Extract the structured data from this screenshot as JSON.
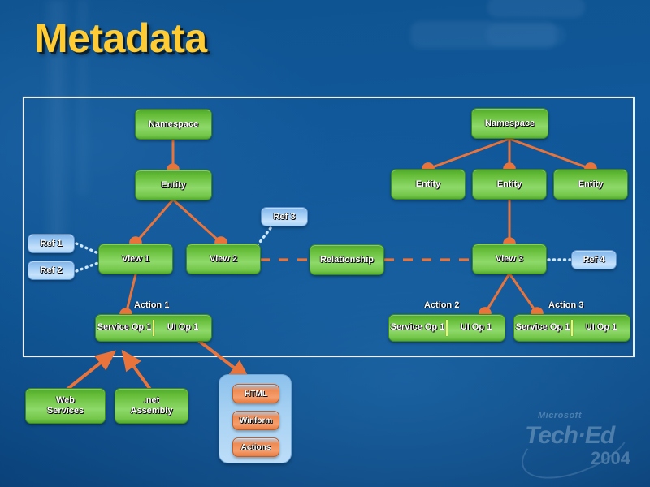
{
  "slide": {
    "title": "Metadata",
    "title_color": "#FFCC33",
    "background_color": "#0f5390"
  },
  "colors": {
    "node_green": "#7ecb4e",
    "node_blue": "#a8d2f3",
    "node_orange": "#ef8a52",
    "connector_orange": "#e8743c",
    "frame_border": "#e9f3f7",
    "divider_yellow": "#f2f277"
  },
  "diagram": {
    "left_tree": {
      "namespace": "Namespace",
      "entity": "Entity",
      "views": [
        "View 1",
        "View 2"
      ],
      "refs": [
        "Ref 1",
        "Ref 2",
        "Ref 3"
      ],
      "action_label": "Action 1",
      "action_cells": [
        "Service Op 1",
        "UI Op 1"
      ]
    },
    "center": {
      "relationship": "Relationship"
    },
    "right_tree": {
      "namespace": "Namespace",
      "entities": [
        "Entity",
        "Entity",
        "Entity"
      ],
      "view": "View 3",
      "ref": "Ref 4",
      "actions": [
        {
          "label": "Action 2",
          "cells": [
            "Service Op 1",
            "UI Op 1"
          ]
        },
        {
          "label": "Action 3",
          "cells": [
            "Service Op 1",
            "UI Op 1"
          ]
        }
      ]
    }
  },
  "outputs": {
    "web_services": [
      "Web",
      "Services"
    ],
    "net_assembly": [
      ".net",
      "Assembly"
    ],
    "ui_panel_items": [
      "HTML",
      "Winform",
      "Actions"
    ]
  },
  "branding": {
    "microsoft": "Microsoft",
    "event": "Tech·Ed",
    "year": "2004"
  }
}
